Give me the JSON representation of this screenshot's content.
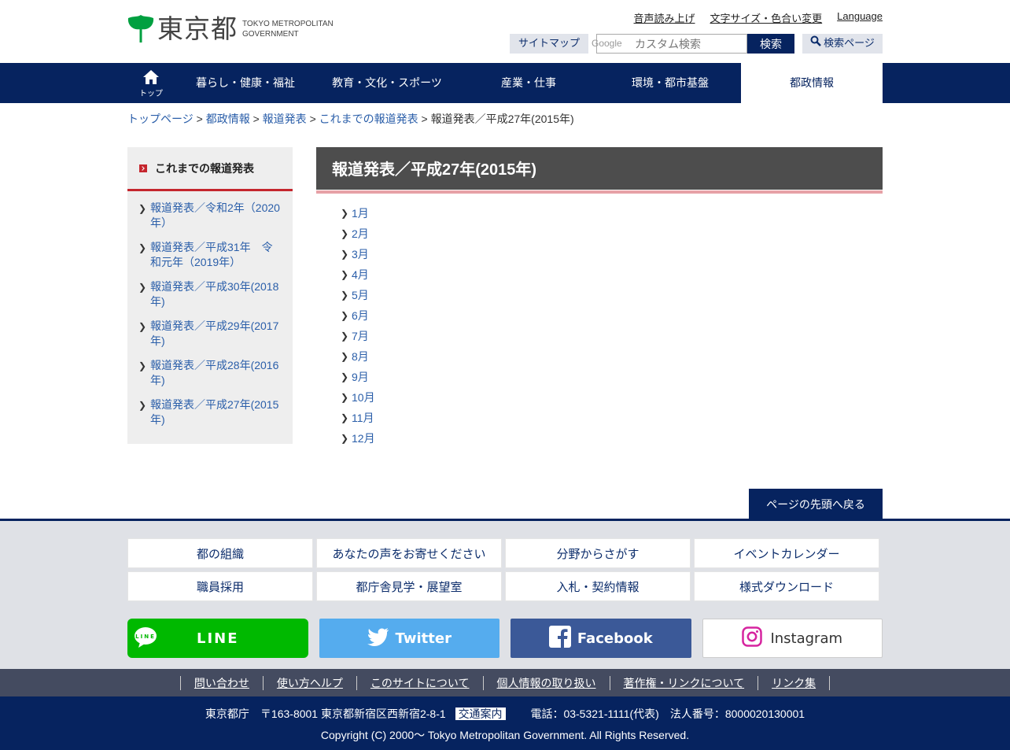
{
  "header": {
    "logo_text": "東京都",
    "logo_en_line1": "TOKYO METROPOLITAN",
    "logo_en_line2": "GOVERNMENT",
    "util_links": [
      "音声読み上げ",
      "文字サイズ・色合い変更",
      "Language"
    ],
    "sitemap_label": "サイトマップ",
    "search_placeholder": "カスタム検索",
    "search_brand": "Google",
    "search_button": "検索",
    "search_page_label": "検索ページ"
  },
  "gnav": {
    "top_label": "トップ",
    "items": [
      "暮らし・健康・福祉",
      "教育・文化・スポーツ",
      "産業・仕事",
      "環境・都市基盤",
      "都政情報"
    ],
    "active_index": 4
  },
  "breadcrumb": {
    "links": [
      "トップページ",
      "都政情報",
      "報道発表",
      "これまでの報道発表"
    ],
    "separator": ">",
    "current": "報道発表／平成27年(2015年)"
  },
  "sidebar": {
    "heading": "これまでの報道発表",
    "items": [
      "報道発表／令和2年（2020年）",
      "報道発表／平成31年　令和元年（2019年）",
      "報道発表／平成30年(2018年)",
      "報道発表／平成29年(2017年)",
      "報道発表／平成28年(2016年)",
      "報道発表／平成27年(2015年)"
    ]
  },
  "main": {
    "title": "報道発表／平成27年(2015年)",
    "months": [
      "1月",
      "2月",
      "3月",
      "4月",
      "5月",
      "6月",
      "7月",
      "8月",
      "9月",
      "10月",
      "11月",
      "12月"
    ]
  },
  "back_to_top": "ページの先頭へ戻る",
  "footer": {
    "grid": [
      "都の組織",
      "あなたの声をお寄せください",
      "分野からさがす",
      "イベントカレンダー",
      "職員採用",
      "都庁舎見学・展望室",
      "入札・契約情報",
      "様式ダウンロード"
    ],
    "sns": [
      "LINE",
      "Twitter",
      "Facebook",
      "Instagram"
    ],
    "links": [
      "問い合わせ",
      "使い方ヘルプ",
      "このサイトについて",
      "個人情報の取り扱い",
      "著作権・リンクについて",
      "リンク集"
    ],
    "address": "東京都庁　〒163-8001 東京都新宿区西新宿2-8-1",
    "access_label": "交通案内",
    "contact": "電話：03-5321-1111(代表)　法人番号：8000020130001",
    "copyright": "Copyright (C) 2000～ Tokyo Metropolitan Government. All Rights Reserved."
  },
  "colors": {
    "navy": "#06235f",
    "accent_red": "#c5262e",
    "link_blue": "#2a5ea9",
    "title_grey": "#4d4d4d",
    "logo_green": "#00a040"
  }
}
